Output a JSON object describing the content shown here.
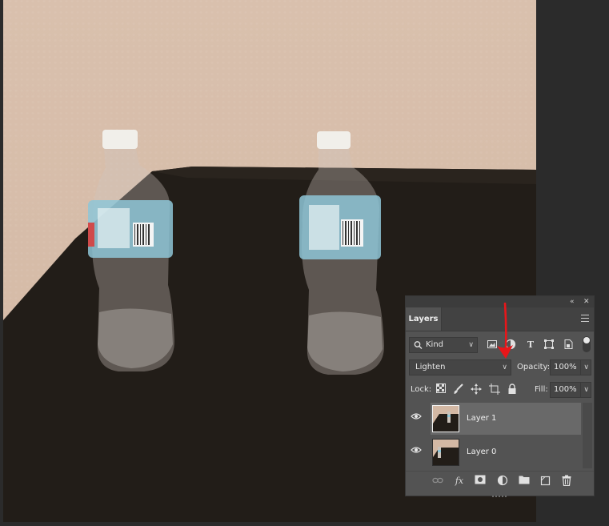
{
  "panel": {
    "title": "Layers",
    "filter_kind": "Kind",
    "blend_mode": "Lighten",
    "opacity_label": "Opacity:",
    "opacity_value": "100%",
    "lock_label": "Lock:",
    "fill_label": "Fill:",
    "fill_value": "100%",
    "layers": [
      {
        "name": "Layer 1",
        "selected": true,
        "visible": true
      },
      {
        "name": "Layer 0",
        "selected": false,
        "visible": true
      }
    ],
    "bottom_bar_icons": [
      "link-layers-icon",
      "fx-icon",
      "add-mask-icon",
      "adjustment-layer-icon",
      "group-folder-icon",
      "new-layer-icon",
      "trash-icon"
    ]
  },
  "colors": {
    "panel_bg": "#535353",
    "selected_row": "#696969",
    "annotation_arrow": "#e8161a"
  }
}
